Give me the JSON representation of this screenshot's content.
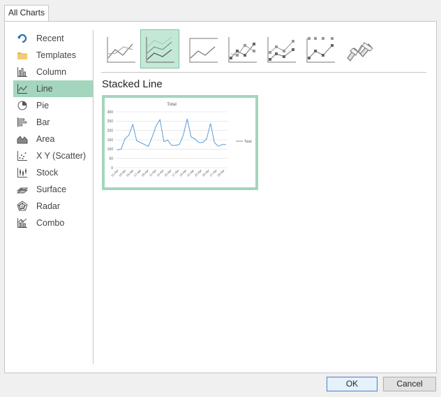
{
  "tabs": {
    "all_charts": "All Charts"
  },
  "sidebar": {
    "items": [
      {
        "label": "Recent",
        "icon": "recent-icon"
      },
      {
        "label": "Templates",
        "icon": "folder-icon"
      },
      {
        "label": "Column",
        "icon": "column-chart-icon"
      },
      {
        "label": "Line",
        "icon": "line-chart-icon",
        "selected": true
      },
      {
        "label": "Pie",
        "icon": "pie-chart-icon"
      },
      {
        "label": "Bar",
        "icon": "bar-chart-icon"
      },
      {
        "label": "Area",
        "icon": "area-chart-icon"
      },
      {
        "label": "X Y (Scatter)",
        "icon": "scatter-chart-icon"
      },
      {
        "label": "Stock",
        "icon": "stock-chart-icon"
      },
      {
        "label": "Surface",
        "icon": "surface-chart-icon"
      },
      {
        "label": "Radar",
        "icon": "radar-chart-icon"
      },
      {
        "label": "Combo",
        "icon": "combo-chart-icon"
      }
    ]
  },
  "subtypes": {
    "items": [
      {
        "icon": "line-icon"
      },
      {
        "icon": "stacked-line-icon",
        "selected": true
      },
      {
        "icon": "100-stacked-line-icon"
      },
      {
        "icon": "line-with-markers-icon"
      },
      {
        "icon": "stacked-line-with-markers-icon"
      },
      {
        "icon": "100-stacked-line-with-markers-icon"
      },
      {
        "icon": "3d-line-icon"
      }
    ],
    "selected_title": "Stacked Line"
  },
  "chart_data": {
    "type": "line",
    "title": "Total",
    "categories": [
      "01-Apr",
      "03-Apr",
      "05-Apr",
      "07-Apr",
      "09-Apr",
      "11-Apr",
      "13-Apr",
      "15-Apr",
      "17-Apr",
      "19-Apr",
      "21-Apr",
      "23-Apr",
      "25-Apr",
      "27-Apr",
      "29-Apr"
    ],
    "series": [
      {
        "name": "Total",
        "values": [
          95,
          100,
          155,
          175,
          232,
          145,
          135,
          125,
          115,
          165,
          225,
          258,
          140,
          148,
          120,
          120,
          125,
          175,
          262,
          165,
          155,
          135,
          135,
          155,
          238,
          135,
          115,
          125,
          125
        ]
      }
    ],
    "ylim": [
      0,
      300
    ],
    "yticks": [
      0,
      50,
      100,
      150,
      200,
      250,
      300
    ],
    "legend": "right",
    "grid": true,
    "series_color": "#5b9bd5"
  },
  "buttons": {
    "ok": "OK",
    "cancel": "Cancel"
  }
}
